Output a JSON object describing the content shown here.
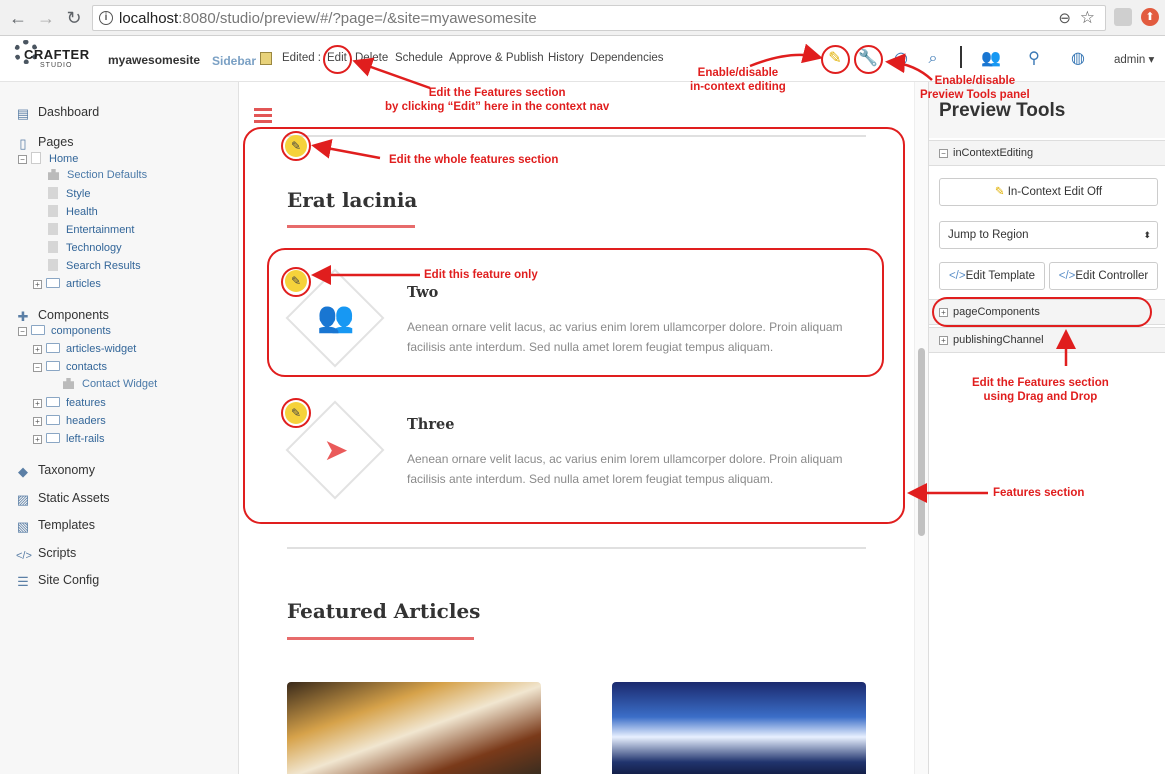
{
  "browser": {
    "url_host": "localhost",
    "url_rest": ":8080/studio/preview/#/?page=/&site=myawesomesite"
  },
  "toolbar": {
    "logo_text": "CRAFTER",
    "logo_sub": "STUDIO",
    "site_name": "myawesomesite",
    "sidebar_label": "Sidebar",
    "edited_label": "Edited :",
    "edit": "Edit",
    "delete": "Delete",
    "schedule": "Schedule",
    "approve_publish": "Approve & Publish",
    "history": "History",
    "dependencies": "Dependencies",
    "admin": "admin"
  },
  "sidebar": {
    "dashboard": "Dashboard",
    "pages": "Pages",
    "home": "Home",
    "page_children": [
      "Section Defaults",
      "Style",
      "Health",
      "Entertainment",
      "Technology",
      "Search Results"
    ],
    "articles": "articles",
    "components": "Components",
    "components_folder": "components",
    "articles_widget": "articles-widget",
    "contacts": "contacts",
    "contact_widget": "Contact Widget",
    "features": "features",
    "headers": "headers",
    "left_rails": "left-rails",
    "taxonomy": "Taxonomy",
    "static_assets": "Static Assets",
    "templates": "Templates",
    "scripts": "Scripts",
    "site_config": "Site Config"
  },
  "preview": {
    "section_title": "Erat lacinia",
    "features": [
      {
        "title": "Two",
        "text": "Aenean ornare velit lacus, ac varius enim lorem ullamcorper dolore. Proin aliquam facilisis ante interdum. Sed nulla amet lorem feugiat tempus aliquam."
      },
      {
        "title": "Three",
        "text": "Aenean ornare velit lacus, ac varius enim lorem ullamcorper dolore. Proin aliquam facilisis ante interdum. Sed nulla amet lorem feugiat tempus aliquam."
      }
    ],
    "featured_title": "Featured Articles"
  },
  "preview_tools": {
    "title": "Preview Tools",
    "in_context_editing": "inContextEditing",
    "ice_button": "In-Context Edit Off",
    "jump_to_region": "Jump to Region",
    "edit_template": "Edit Template",
    "edit_controller": "Edit Controller",
    "page_components": "pageComponents",
    "publishing_channel": "publishingChannel"
  },
  "annotations": {
    "edit_features_nav": "Edit the Features section\nby clicking “Edit” here in the context nav",
    "edit_whole": "Edit the whole features section",
    "edit_feature_only": "Edit this feature only",
    "ice_toggle": "Enable/disable\nin-context editing",
    "tools_toggle": "Enable/disable\nPreview Tools panel",
    "drag_drop": "Edit the Features section\nusing Drag and Drop",
    "features_section": "Features section"
  },
  "colors": {
    "accent": "#e76b6b",
    "annotation": "#e01e1e",
    "link": "#336699"
  }
}
